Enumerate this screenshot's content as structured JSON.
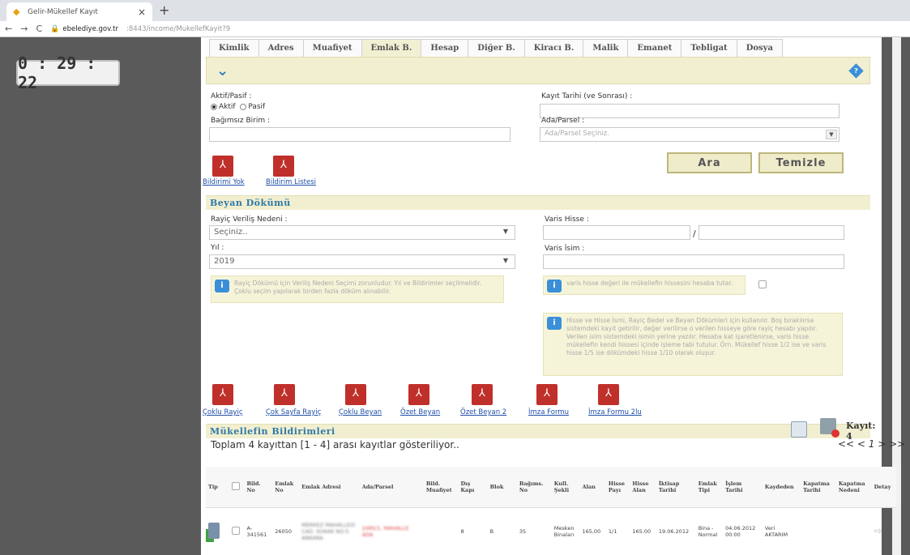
{
  "browser": {
    "tab_title": "Gelir-Mükellef Kayıt",
    "new_tab": "+",
    "close": "×",
    "url_host": "ebelediye.gov.tr",
    "url_rest": ":8443/income/MukellefKayit?9"
  },
  "timer": "0 : 29 : 22",
  "tabs": [
    "Kimlik",
    "Adres",
    "Muafiyet",
    "Emlak B.",
    "Hesap",
    "Diğer B.",
    "Kiracı B.",
    "Malik",
    "Emanet",
    "Tebligat",
    "Dosya"
  ],
  "active_tab": "Emlak B.",
  "filter": {
    "aktif_pasif_label": "Aktif/Pasif :",
    "aktif": "Aktif",
    "pasif": "Pasif",
    "bagimsiz_birim_label": "Bağımsız Birim :",
    "kayit_tarihi_label": "Kayıt Tarihi (ve Sonrası) :",
    "ada_parsel_label": "Ada/Parsel :",
    "ada_parsel_placeholder": "Ada/Parsel Seçiniz.",
    "ara": "Ara",
    "temizle": "Temizle",
    "bildirimi_yok": "Bildirimi Yok",
    "bildirim_listesi": "Bildirim Listesi"
  },
  "beyan": {
    "title": "Beyan Dökümü",
    "rayic_label": "Rayiç Veriliş Nedeni :",
    "rayic_value": "Seçiniz..",
    "yil_label": "Yıl :",
    "yil_value": "2019",
    "varis_hisse_label": "Varis Hisse :",
    "varis_sep": "/",
    "varis_isim_label": "Varis İsim :",
    "info1": "Rayiç Dökümü için Veriliş Nedeni Seçimi zorunludur. Yıl ve Bildirimler seçilmelidir. Çoklu seçim yapılarak birden fazla döküm alınabilir.",
    "info2": "varis hisse değeri ile mükellefin hissesini hesaba tutar.",
    "info3": "Hisse ve Hisse İsmi, Rayiç Bedel ve Beyan Dökümleri için kullanılır. Boş bırakılırsa sistemdeki kayıt getirilir, değer verilirse o verilen hisseye göre rayiç hesabı yapılır. Verilen isim sistemdeki ismin yerine yazılır. Hesaba kat işaretlenirse, varis hisse mükellefin kendi hissesi içinde işleme tabi tutulur. Örn. Mükellef hisse 1/2 ise ve varis hisse 1/5 ise dökümdeki hisse 1/10 olarak oluşur.",
    "pdf_links": [
      "Çoklu Rayiç",
      "Çok Sayfa Rayiç",
      "Çoklu Beyan",
      "Özet Beyan",
      "Özet Beyan 2",
      "İmza Formu",
      "İmza Formu 2lu"
    ]
  },
  "bildirimler": {
    "title": "Mükellefin Bildirimleri",
    "kayit": "Kayıt: 4",
    "toplam": "Toplam 4 kayıttan [1 - 4] arası kayıtlar gösteriliyor..",
    "pager": "<< < 1 > >>",
    "columns": [
      "Tip",
      "",
      "Bild. No",
      "Emlak No",
      "Emlak Adresi",
      "Ada/Parsel",
      "Bild. Muafiyet",
      "Dış Kapı",
      "Blok",
      "Bağıms. No",
      "Kull. Şekli",
      "Alan",
      "Hisse Payı",
      "Hisse Alan",
      "İktisap Tarihi",
      "Emlak Tipi",
      "İşlem Tarihi",
      "Kaydeden",
      "Kapatma Tarihi",
      "Kapatma Nedeni",
      "Detay"
    ],
    "row": {
      "bild_no": "A-341561",
      "emlak_no": "26050",
      "emlak_adresi": "MERKEZ MAHALLESİ CAD. SOKAK NO:5 ANKARA",
      "ada_parsel": "2485/1, MAHALLE ADA",
      "dis_kapi": "8",
      "blok": "B",
      "bagims_no": "35",
      "kull_sekli": "Mesken Binaları",
      "alan": "165,00",
      "hisse_payi": "1/1",
      "hisse_alan": "165.00",
      "iktisap_tarihi": "19.06.2012",
      "emlak_tipi": "Bina - Normal",
      "islem_tarihi": "04.06.2012 00:00",
      "kaydeden": "Veri AKTARIM"
    }
  }
}
